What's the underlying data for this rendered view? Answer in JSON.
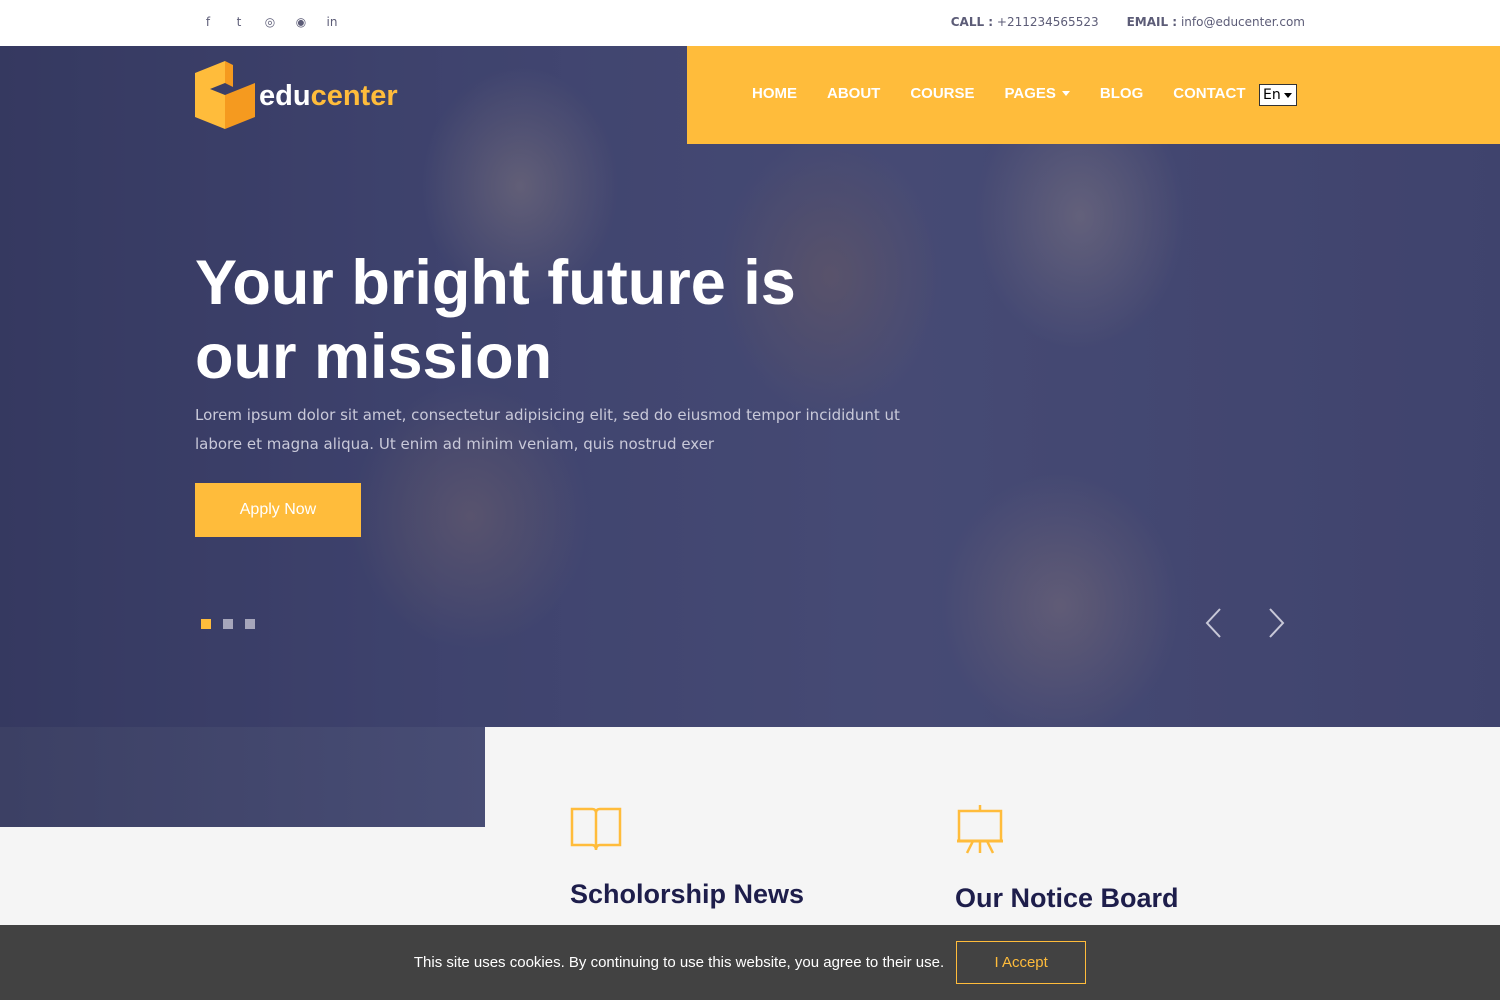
{
  "topbar": {
    "social": [
      {
        "name": "facebook-icon",
        "glyph": "f"
      },
      {
        "name": "twitter-icon",
        "glyph": "t"
      },
      {
        "name": "instagram-icon",
        "glyph": "◎"
      },
      {
        "name": "github-icon",
        "glyph": "◉"
      },
      {
        "name": "linkedin-icon",
        "glyph": "in"
      }
    ],
    "call_label": "CALL :",
    "call_value": "+211234565523",
    "email_label": "EMAIL :",
    "email_value": "info@educenter.com"
  },
  "logo": {
    "part1": "edu",
    "part2": "center"
  },
  "nav": {
    "items": [
      "HOME",
      "ABOUT",
      "COURSE",
      "PAGES",
      "BLOG",
      "CONTACT"
    ],
    "language": "En"
  },
  "hero": {
    "title": "Your bright future is our mission",
    "text": "Lorem ipsum dolor sit amet, consectetur adipisicing elit, sed do eiusmod tempor incididunt ut labore et magna aliqua. Ut enim ad minim veniam, quis nostrud exer",
    "button": "Apply Now",
    "slides": 3,
    "active_slide": 1
  },
  "features": [
    {
      "title": "Scholorship News",
      "icon": "book-icon"
    },
    {
      "title": "Our Notice Board",
      "icon": "notice-board-icon"
    }
  ],
  "cookie": {
    "text": "This site uses cookies. By continuing to use this website, you agree to their use.",
    "button": "I Accept"
  },
  "colors": {
    "accent": "#ffbc3b",
    "heading": "#1e1e4b"
  }
}
